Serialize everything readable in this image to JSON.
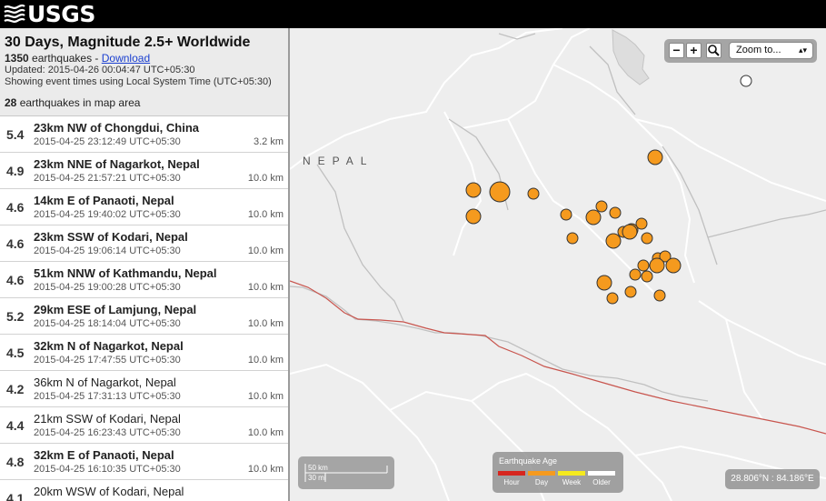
{
  "header": {
    "logo_text": "USGS"
  },
  "feed": {
    "title": "30 Days, Magnitude 2.5+ Worldwide",
    "count_number": "1350",
    "count_suffix": " earthquakes - ",
    "download_label": "Download",
    "updated": "Updated: 2015-04-26 00:04:47 UTC+05:30",
    "timezone_note": "Showing event times using Local System Time (UTC+05:30)",
    "in_area_number": "28",
    "in_area_suffix": " earthquakes in map area"
  },
  "earthquakes": [
    {
      "mag": "5.4",
      "place": "23km NW of Chongdui, China",
      "time": "2015-04-25 23:12:49 UTC+05:30",
      "depth": "3.2 km"
    },
    {
      "mag": "4.9",
      "place": "23km NNE of Nagarkot, Nepal",
      "time": "2015-04-25 21:57:21 UTC+05:30",
      "depth": "10.0 km"
    },
    {
      "mag": "4.6",
      "place": "14km E of Panaoti, Nepal",
      "time": "2015-04-25 19:40:02 UTC+05:30",
      "depth": "10.0 km"
    },
    {
      "mag": "4.6",
      "place": "23km SSW of Kodari, Nepal",
      "time": "2015-04-25 19:06:14 UTC+05:30",
      "depth": "10.0 km"
    },
    {
      "mag": "4.6",
      "place": "51km NNW of Kathmandu, Nepal",
      "time": "2015-04-25 19:00:28 UTC+05:30",
      "depth": "10.0 km"
    },
    {
      "mag": "5.2",
      "place": "29km ESE of Lamjung, Nepal",
      "time": "2015-04-25 18:14:04 UTC+05:30",
      "depth": "10.0 km"
    },
    {
      "mag": "4.5",
      "place": "32km N of Nagarkot, Nepal",
      "time": "2015-04-25 17:47:55 UTC+05:30",
      "depth": "10.0 km"
    },
    {
      "mag": "4.2",
      "place": "36km N of Nagarkot, Nepal",
      "time": "2015-04-25 17:31:13 UTC+05:30",
      "depth": "10.0 km"
    },
    {
      "mag": "4.4",
      "place": "21km SSW of Kodari, Nepal",
      "time": "2015-04-25 16:23:43 UTC+05:30",
      "depth": "10.0 km"
    },
    {
      "mag": "4.8",
      "place": "32km E of Panaoti, Nepal",
      "time": "2015-04-25 16:10:35 UTC+05:30",
      "depth": "10.0 km"
    },
    {
      "mag": "4.1",
      "place": "20km WSW of Kodari, Nepal",
      "time": "",
      "depth": ""
    }
  ],
  "map": {
    "country_label": "NEPAL",
    "zoom_out_label": "−",
    "zoom_in_label": "+",
    "zoom_select_label": "Zoom to...",
    "scale_km": "50 km",
    "scale_mi": "30 mi",
    "legend_title": "Earthquake Age",
    "legend": [
      {
        "label": "Hour",
        "color": "#d7261e"
      },
      {
        "label": "Day",
        "color": "#f59a1e"
      },
      {
        "label": "Week",
        "color": "#f5ea1e"
      },
      {
        "label": "Older",
        "color": "#ffffff"
      }
    ],
    "coordinates": "28.806°N : 84.186°E",
    "quake_color": "#f59a1e"
  }
}
